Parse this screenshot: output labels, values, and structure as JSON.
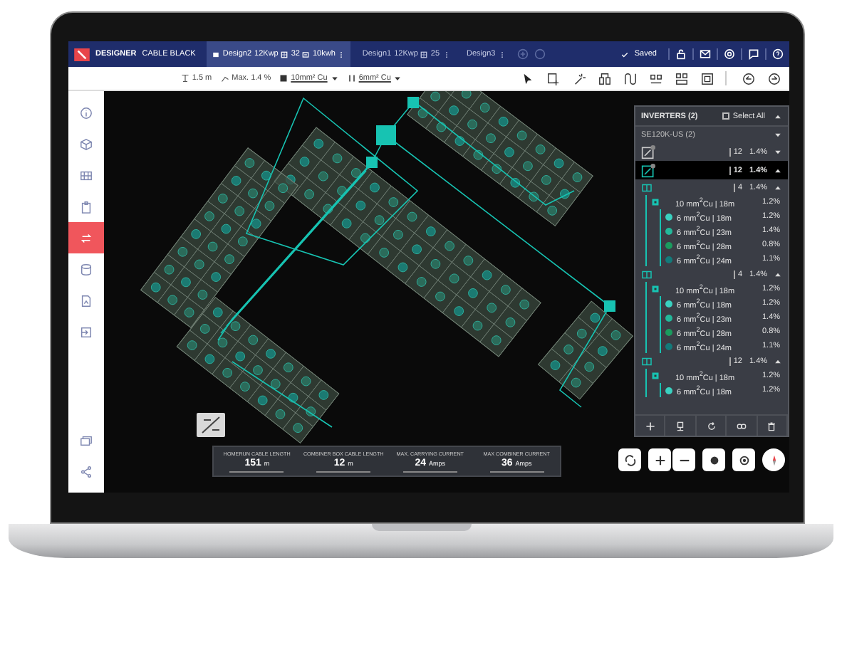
{
  "top_bar": {
    "app_name": "DESIGNER",
    "project": "CABLE BLACK",
    "status": "Saved",
    "tabs": [
      {
        "name": "Design2",
        "capacity": "12Kwp",
        "panels": "32",
        "storage": "10kwh",
        "selected": true
      },
      {
        "name": "Design1",
        "capacity": "12Kwp",
        "panels": "25",
        "selected": false
      },
      {
        "name": "Design3",
        "selected": false
      }
    ]
  },
  "toolbar": {
    "cable_gap": "1.5 m",
    "max_drop": "Max. 1.4 %",
    "homerun_cable": "10mm² Cu",
    "string_cable": "6mm² Cu"
  },
  "sidebar": {
    "items": [
      {
        "selected": false
      },
      {
        "selected": false
      },
      {
        "selected": false
      },
      {
        "selected": false
      },
      {
        "selected": true
      },
      {
        "selected": false
      },
      {
        "selected": false
      },
      {
        "selected": false
      },
      {
        "selected": false
      },
      {
        "selected": false
      }
    ]
  },
  "panel": {
    "title": "INVERTERS (2)",
    "select_all": {
      "label": "Select All",
      "checked": false
    },
    "model": "SE120K-US (2)",
    "inverters": [
      {
        "strings": "12",
        "loss": "1.4%",
        "expanded": false,
        "selected": false
      },
      {
        "strings": "12",
        "loss": "1.4%",
        "expanded": true,
        "selected": true
      }
    ],
    "groups": [
      {
        "strings": "4",
        "loss": "1.4%",
        "expanded": true,
        "feeder": {
          "cable": "10 mm$^{2}$Cu | 18m",
          "loss": "1.2%",
          "branches": [
            {
              "cable": "6 mm$^{2}$Cu | 18m",
              "loss": "1.2%",
              "color": "#3ad1c0"
            },
            {
              "cable": "6 mm$^{2}$Cu | 23m",
              "loss": "1.4%",
              "color": "#23b89a"
            },
            {
              "cable": "6 mm$^{2}$Cu | 28m",
              "loss": "0.8%",
              "color": "#1a9b5e"
            },
            {
              "cable": "6 mm$^{2}$Cu | 24m",
              "loss": "1.1%",
              "color": "#137a7a"
            }
          ]
        }
      },
      {
        "strings": "4",
        "loss": "1.4%",
        "expanded": true,
        "feeder": {
          "cable": "10 mm$^{2}$Cu | 18m",
          "loss": "1.2%",
          "branches": [
            {
              "cable": "6 mm$^{2}$Cu | 18m",
              "loss": "1.2%",
              "color": "#3ad1c0"
            },
            {
              "cable": "6 mm$^{2}$Cu | 23m",
              "loss": "1.4%",
              "color": "#23b89a"
            },
            {
              "cable": "6 mm$^{2}$Cu | 28m",
              "loss": "0.8%",
              "color": "#1a9b5e"
            },
            {
              "cable": "6 mm$^{2}$Cu | 24m",
              "loss": "1.1%",
              "color": "#137a7a"
            }
          ]
        }
      },
      {
        "strings": "12",
        "loss": "1.4%",
        "expanded": true,
        "feeder": {
          "cable": "10 mm$^{2}$Cu | 18m",
          "loss": "1.2%",
          "branches": [
            {
              "cable": "6 mm$^{2}$Cu | 18m",
              "loss": "1.2%",
              "color": "#3ad1c0"
            }
          ]
        }
      }
    ]
  },
  "stats": [
    {
      "label": "HOMERUN CABLE LENGTH",
      "value": "151",
      "unit": "m"
    },
    {
      "label": "COMBINER BOX CABLE LENGTH",
      "value": "12",
      "unit": "m"
    },
    {
      "label": "MAX. CARRYING CURRENT",
      "value": "24",
      "unit": "Amps"
    },
    {
      "label": "MAX COMBINER CURRENT",
      "value": "36",
      "unit": "Amps"
    }
  ]
}
